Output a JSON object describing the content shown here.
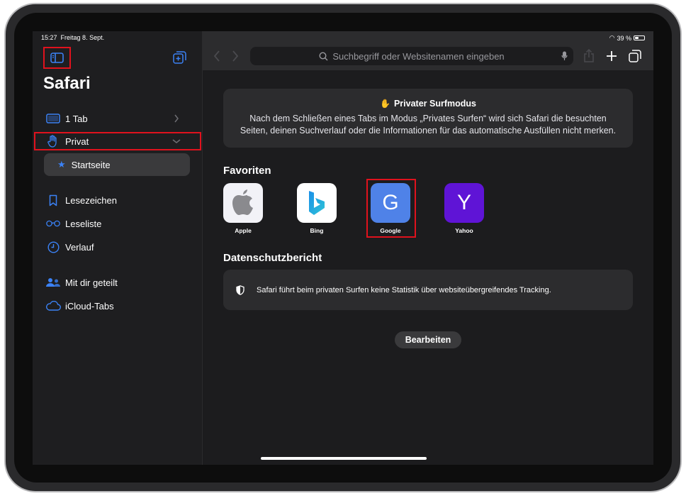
{
  "status": {
    "time": "15:27",
    "date": "Freitag 8. Sept.",
    "battery": "39 %",
    "battery_level": 0.39
  },
  "sidebar": {
    "title": "Safari",
    "tab_groups": [
      {
        "label": "1 Tab",
        "icon": "tablet-icon"
      },
      {
        "label": "Privat",
        "icon": "hand-icon"
      }
    ],
    "startseite": "Startseite",
    "items": [
      {
        "label": "Lesezeichen",
        "icon": "bookmark-icon"
      },
      {
        "label": "Leseliste",
        "icon": "glasses-icon"
      },
      {
        "label": "Verlauf",
        "icon": "clock-icon"
      },
      {
        "label": "Mit dir geteilt",
        "icon": "shared-people-icon"
      },
      {
        "label": "iCloud-Tabs",
        "icon": "cloud-icon"
      }
    ]
  },
  "toolbar": {
    "search_placeholder": "Suchbegriff oder Websitenamen eingeben"
  },
  "private_notice": {
    "title": "Privater Surfmodus",
    "body": "Nach dem Schließen eines Tabs im Modus „Privates Surfen“ wird sich Safari die besuchten Seiten, deinen Suchverlauf oder die Informationen für das automatische Ausfüllen nicht merken."
  },
  "favorites": {
    "heading": "Favoriten",
    "items": [
      {
        "label": "Apple",
        "glyph": "",
        "color": "#f2f2f7"
      },
      {
        "label": "Bing",
        "glyph": "b",
        "color": "#ffffff"
      },
      {
        "label": "Google",
        "glyph": "G",
        "color": "#4f82e8"
      },
      {
        "label": "Yahoo",
        "glyph": "Y",
        "color": "#5f14d6"
      }
    ]
  },
  "privacy_report": {
    "heading": "Datenschutzbericht",
    "text": "Safari führt beim privaten Surfen keine Statistik über websiteübergreifendes Tracking."
  },
  "edit_label": "Bearbeiten",
  "colors": {
    "accent": "#3b82f6",
    "highlight": "#e0121d",
    "background": "#1c1c1e"
  }
}
